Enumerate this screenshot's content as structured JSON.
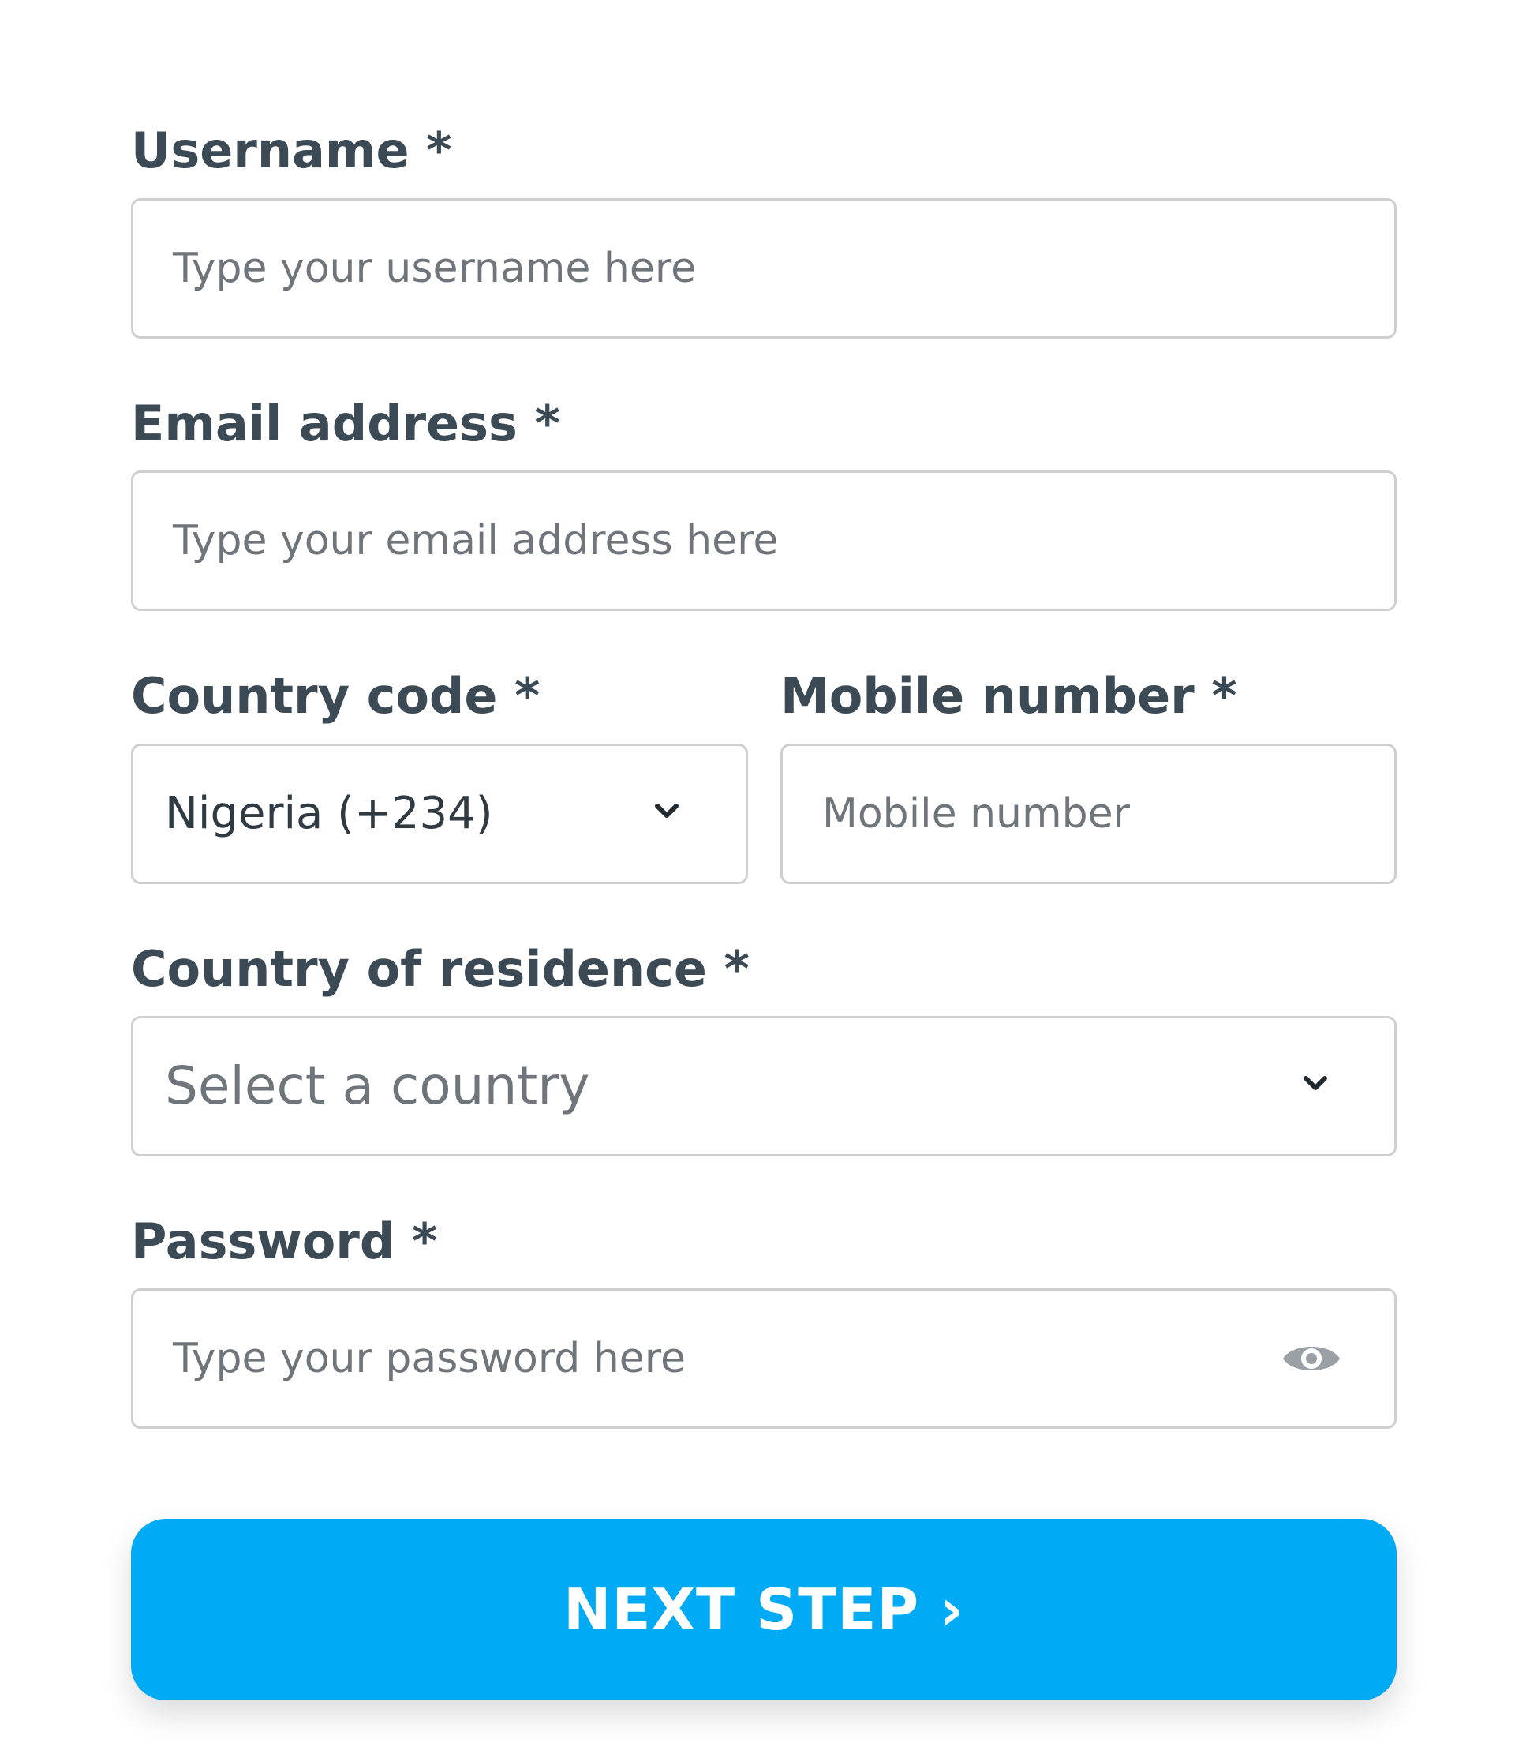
{
  "form": {
    "username": {
      "label": "Username *",
      "placeholder": "Type your username here"
    },
    "email": {
      "label": "Email address *",
      "placeholder": "Type your email address here"
    },
    "country_code": {
      "label": "Country code *",
      "value": "Nigeria (+234)",
      "icon": "chevron-down-icon"
    },
    "mobile": {
      "label": "Mobile number *",
      "placeholder": "Mobile number"
    },
    "residence": {
      "label": "Country of residence *",
      "placeholder": "Select a country",
      "icon": "chevron-down-icon"
    },
    "password": {
      "label": "Password *",
      "placeholder": "Type your password here",
      "icon": "eye-icon"
    }
  },
  "actions": {
    "next_label": "NEXT STEP ›"
  },
  "colors": {
    "primary": "#00aaf5",
    "label_text": "#3c4a55",
    "border": "#cfcfcf",
    "placeholder_text": "#6f757a"
  }
}
